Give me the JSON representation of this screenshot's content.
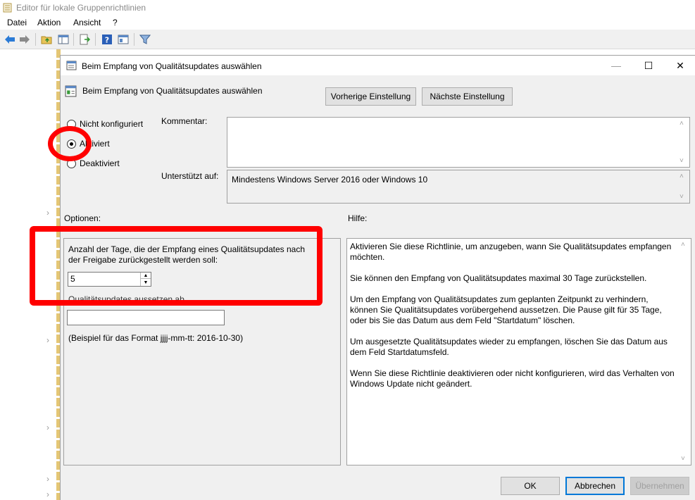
{
  "back_window": {
    "title": "Editor für lokale Gruppenrichtlinien",
    "menu": [
      "Datei",
      "Aktion",
      "Ansicht",
      "?"
    ]
  },
  "dialog": {
    "title": "Beim Empfang von Qualitätsupdates auswählen",
    "header": "Beim Empfang von Qualitätsupdates auswählen",
    "prev_button": "Vorherige Einstellung",
    "next_button": "Nächste Einstellung",
    "radio": {
      "not_configured": "Nicht konfiguriert",
      "enabled": "Aktiviert",
      "disabled": "Deaktiviert",
      "selected": "enabled"
    },
    "comment_label": "Kommentar:",
    "supported_label": "Unterstützt auf:",
    "supported_value": "Mindestens Windows Server 2016 oder Windows 10",
    "options_label": "Optionen:",
    "help_label": "Hilfe:",
    "options": {
      "days_label": "Anzahl der Tage, die der Empfang eines Qualitätsupdates nach der Freigabe zurückgestellt werden soll:",
      "days_value": "5",
      "pause_label": "Qualitätsupdates aussetzen ab",
      "pause_value": "",
      "format_hint": "(Beispiel für das Format jjjj-mm-tt: 2016-10-30)"
    },
    "help_paragraphs": [
      "Aktivieren Sie diese Richtlinie, um anzugeben, wann Sie Qualitätsupdates empfangen möchten.",
      "Sie können den Empfang von Qualitätsupdates maximal 30 Tage zurückstellen.",
      "Um den Empfang von Qualitätsupdates zum geplanten Zeitpunkt zu verhindern, können Sie Qualitätsupdates vorübergehend aussetzen. Die Pause gilt für 35 Tage, oder bis Sie das Datum aus dem Feld \"Startdatum\" löschen.",
      "Um ausgesetzte Qualitätsupdates wieder zu empfangen, löschen Sie das Datum aus dem Feld Startdatumsfeld.",
      "Wenn Sie diese Richtlinie deaktivieren oder nicht konfigurieren, wird das Verhalten von Windows Update nicht geändert."
    ],
    "ok_button": "OK",
    "cancel_button": "Abbrechen",
    "apply_button": "Übernehmen"
  },
  "icons": {
    "back": "back-arrow-icon",
    "forward": "forward-arrow-icon",
    "filter": "filter-icon",
    "help": "help-icon"
  },
  "colors": {
    "annotation_red": "#ff0000",
    "dialog_bg": "#f0f0f0",
    "focus_blue": "#0078d7"
  }
}
